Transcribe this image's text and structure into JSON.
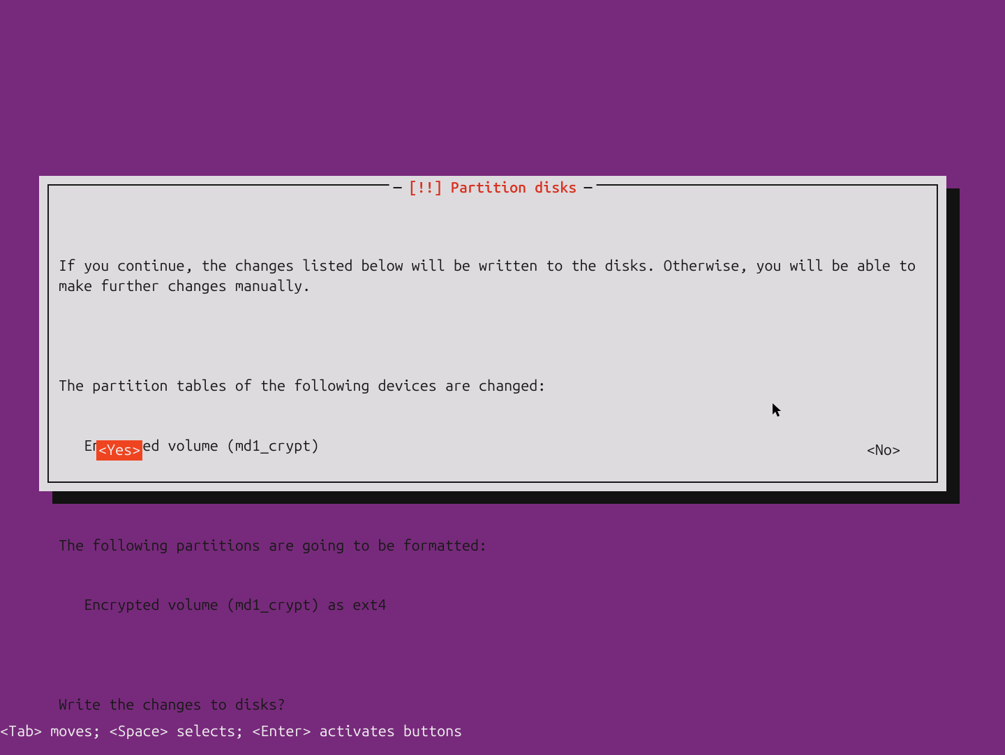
{
  "dialog": {
    "title": "[!!] Partition disks",
    "paragraphs": [
      "If you continue, the changes listed below will be written to the disks. Otherwise, you will be able to make further changes manually.",
      "",
      "The partition tables of the following devices are changed:",
      "   Encrypted volume (md1_crypt)",
      "",
      "The following partitions are going to be formatted:",
      "   Encrypted volume (md1_crypt) as ext4",
      "",
      "Write the changes to disks?"
    ],
    "yes_label": "<Yes>",
    "no_label": "<No>",
    "selected": "yes"
  },
  "help_text": "<Tab> moves; <Space> selects; <Enter> activates buttons",
  "colors": {
    "background": "#772a7b",
    "dialog_bg": "#dedbde",
    "shadow": "#121212",
    "text": "#181818",
    "title": "#d73220",
    "highlight_bg": "#ef4420",
    "highlight_fg": "#efefef",
    "help_fg": "#efefef"
  }
}
